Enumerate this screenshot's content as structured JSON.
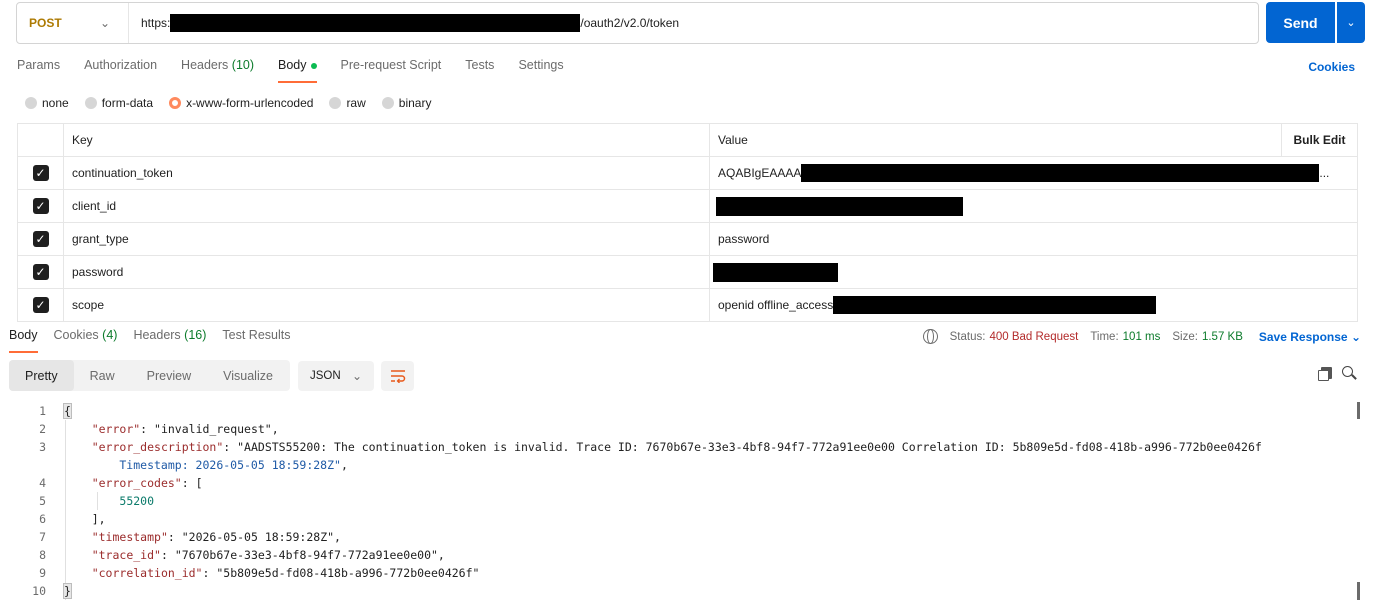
{
  "request": {
    "method": "POST",
    "url_prefix": "https:",
    "url_suffix": "/oauth2/v2.0/token",
    "send_label": "Send"
  },
  "req_tabs": {
    "params": "Params",
    "authorization": "Authorization",
    "headers": "Headers",
    "headers_count": "(10)",
    "body": "Body",
    "prerequest": "Pre-request Script",
    "tests": "Tests",
    "settings": "Settings",
    "cookies": "Cookies"
  },
  "body_types": [
    "none",
    "form-data",
    "x-www-form-urlencoded",
    "raw",
    "binary"
  ],
  "body_type_selected": "x-www-form-urlencoded",
  "params_table": {
    "col_key": "Key",
    "col_value": "Value",
    "bulk_edit": "Bulk Edit",
    "rows": [
      {
        "key": "continuation_token",
        "value": "AQABIgEAAAA",
        "value_tail": "...",
        "checked": true
      },
      {
        "key": "client_id",
        "value": "",
        "checked": true
      },
      {
        "key": "grant_type",
        "value": "password",
        "checked": true
      },
      {
        "key": "password",
        "value": "",
        "checked": true
      },
      {
        "key": "scope",
        "value": "openid offline_access",
        "checked": true
      }
    ]
  },
  "resp_tabs": {
    "body": "Body",
    "cookies": "Cookies",
    "cookies_count": "(4)",
    "headers": "Headers",
    "headers_count": "(16)",
    "test_results": "Test Results"
  },
  "status_bar": {
    "status_label": "Status:",
    "status_value": "400 Bad Request",
    "time_label": "Time:",
    "time_value": "101 ms",
    "size_label": "Size:",
    "size_value": "1.57 KB",
    "save_response": "Save Response"
  },
  "view_modes": [
    "Pretty",
    "Raw",
    "Preview",
    "Visualize"
  ],
  "view_selected": "Pretty",
  "format": "JSON",
  "response_lines": [
    {
      "n": "1",
      "text": "{"
    },
    {
      "n": "2",
      "text": "    \"error\": \"invalid_request\","
    },
    {
      "n": "3",
      "text": "    \"error_description\": \"AADSTS55200: The continuation_token is invalid. Trace ID: 7670b67e-33e3-4bf8-94f7-772a91ee0e00 Correlation ID: 5b809e5d-fd08-418b-a996-772b0ee0426f"
    },
    {
      "n": "",
      "text": "        Timestamp: 2026-05-05 18:59:28Z\","
    },
    {
      "n": "4",
      "text": "    \"error_codes\": ["
    },
    {
      "n": "5",
      "text": "        55200"
    },
    {
      "n": "6",
      "text": "    ],"
    },
    {
      "n": "7",
      "text": "    \"timestamp\": \"2026-05-05 18:59:28Z\","
    },
    {
      "n": "8",
      "text": "    \"trace_id\": \"7670b67e-33e3-4bf8-94f7-772a91ee0e00\","
    },
    {
      "n": "9",
      "text": "    \"correlation_id\": \"5b809e5d-fd08-418b-a996-772b0ee0426f\""
    },
    {
      "n": "10",
      "text": "}"
    }
  ]
}
